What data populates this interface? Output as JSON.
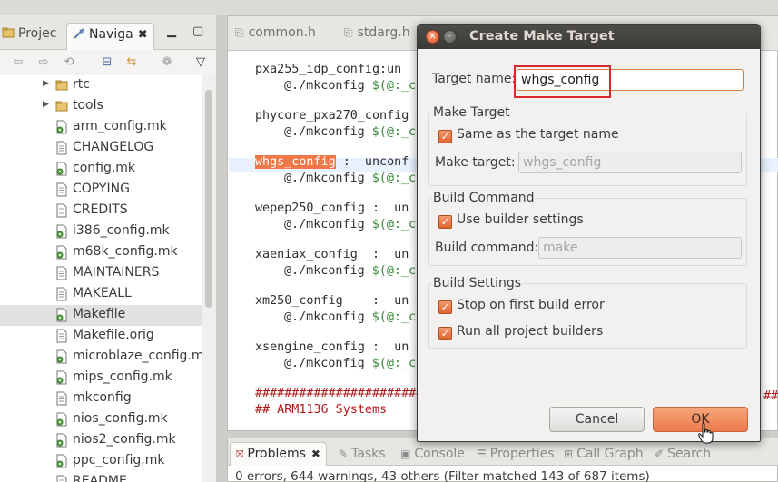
{
  "colors": {
    "accent": "#e07a3e",
    "highlight_box": "#d8282c",
    "selected_text_bg": "#f07746"
  },
  "navigator": {
    "tabs": [
      {
        "label": "Projec"
      },
      {
        "label": "Naviga",
        "active": true
      }
    ],
    "view_buttons": [
      "minimize-icon",
      "maximize-icon"
    ],
    "toolbar_icons": [
      "back-arrow-icon",
      "forward-arrow-icon",
      "up-folder-icon",
      "collapse-all-icon",
      "link-with-editor-icon",
      "new-project-icon",
      "view-menu-icon"
    ],
    "items": [
      {
        "label": "rtc",
        "type": "folder"
      },
      {
        "label": "tools",
        "type": "folder"
      },
      {
        "label": "arm_config.mk",
        "type": "make-file"
      },
      {
        "label": "CHANGELOG",
        "type": "text-file"
      },
      {
        "label": "config.mk",
        "type": "make-file"
      },
      {
        "label": "COPYING",
        "type": "text-file"
      },
      {
        "label": "CREDITS",
        "type": "text-file"
      },
      {
        "label": "i386_config.mk",
        "type": "make-file"
      },
      {
        "label": "m68k_config.mk",
        "type": "make-file"
      },
      {
        "label": "MAINTAINERS",
        "type": "text-file"
      },
      {
        "label": "MAKEALL",
        "type": "text-file"
      },
      {
        "label": "Makefile",
        "type": "make-file",
        "selected": true
      },
      {
        "label": "Makefile.orig",
        "type": "text-file"
      },
      {
        "label": "microblaze_config.m",
        "type": "make-file"
      },
      {
        "label": "mips_config.mk",
        "type": "make-file"
      },
      {
        "label": "mkconfig",
        "type": "text-file"
      },
      {
        "label": "nios_config.mk",
        "type": "make-file"
      },
      {
        "label": "nios2_config.mk",
        "type": "make-file"
      },
      {
        "label": "ppc_config.mk",
        "type": "make-file"
      },
      {
        "label": "README",
        "type": "text-file"
      }
    ]
  },
  "editor": {
    "tabs": [
      "common.h",
      "stdarg.h"
    ],
    "lines": [
      {
        "target": "pxa255_idp_config:",
        "suffix": "un"
      },
      {
        "cmd": "@./mkconfig ",
        "var": "$(@:_c"
      },
      {
        "target": "phycore_pxa270_config",
        "suffix": ""
      },
      {
        "cmd": "@./mkconfig ",
        "var": "$(@:_c"
      },
      {
        "target": "whgs_config",
        "suffix": " :  unconf"
      },
      {
        "cmd": "@./mkconfig ",
        "var": "$(@:_c"
      },
      {
        "target": "wepep250_config :",
        "suffix": "  un"
      },
      {
        "cmd": "@./mkconfig ",
        "var": "$(@:_c"
      },
      {
        "target": "xaeniax_config  :",
        "suffix": "  un"
      },
      {
        "cmd": "@./mkconfig ",
        "var": "$(@:_c"
      },
      {
        "target": "xm250_config    :",
        "suffix": "  un"
      },
      {
        "cmd": "@./mkconfig ",
        "var": "$(@:_c"
      },
      {
        "target": "xsengine_config :",
        "suffix": "  un"
      },
      {
        "cmd": "@./mkconfig ",
        "var": "$(@:_c"
      },
      {
        "hash": "##########################"
      },
      {
        "hash": "## ARM1136 Systems"
      }
    ],
    "right_hashes": "##"
  },
  "bottom": {
    "tabs": [
      {
        "label": "Problems",
        "active": true,
        "icon": "problems-icon"
      },
      {
        "label": "Tasks",
        "icon": "tasks-icon"
      },
      {
        "label": "Console",
        "icon": "console-icon"
      },
      {
        "label": "Properties",
        "icon": "properties-icon"
      },
      {
        "label": "Call Graph",
        "icon": "call-graph-icon"
      },
      {
        "label": "Search",
        "icon": "search-icon"
      }
    ],
    "status": "0 errors, 644 warnings, 43 others (Filter matched 143 of 687 items)"
  },
  "dialog": {
    "title": "Create Make Target",
    "target_name_label": "Target name:",
    "target_name_value": "whgs_config",
    "make_target_group": "Make Target",
    "same_as_target_label": "Same as the target name",
    "same_as_target_checked": true,
    "make_target_label": "Make target:",
    "make_target_value": "whgs_config",
    "build_command_group": "Build Command",
    "use_builder_label": "Use builder settings",
    "use_builder_checked": true,
    "build_command_label": "Build command:",
    "build_command_value": "make",
    "build_settings_group": "Build Settings",
    "stop_on_error_label": "Stop on first build error",
    "stop_on_error_checked": true,
    "run_all_label": "Run all project builders",
    "run_all_checked": true,
    "cancel_label": "Cancel",
    "ok_label": "OK"
  }
}
